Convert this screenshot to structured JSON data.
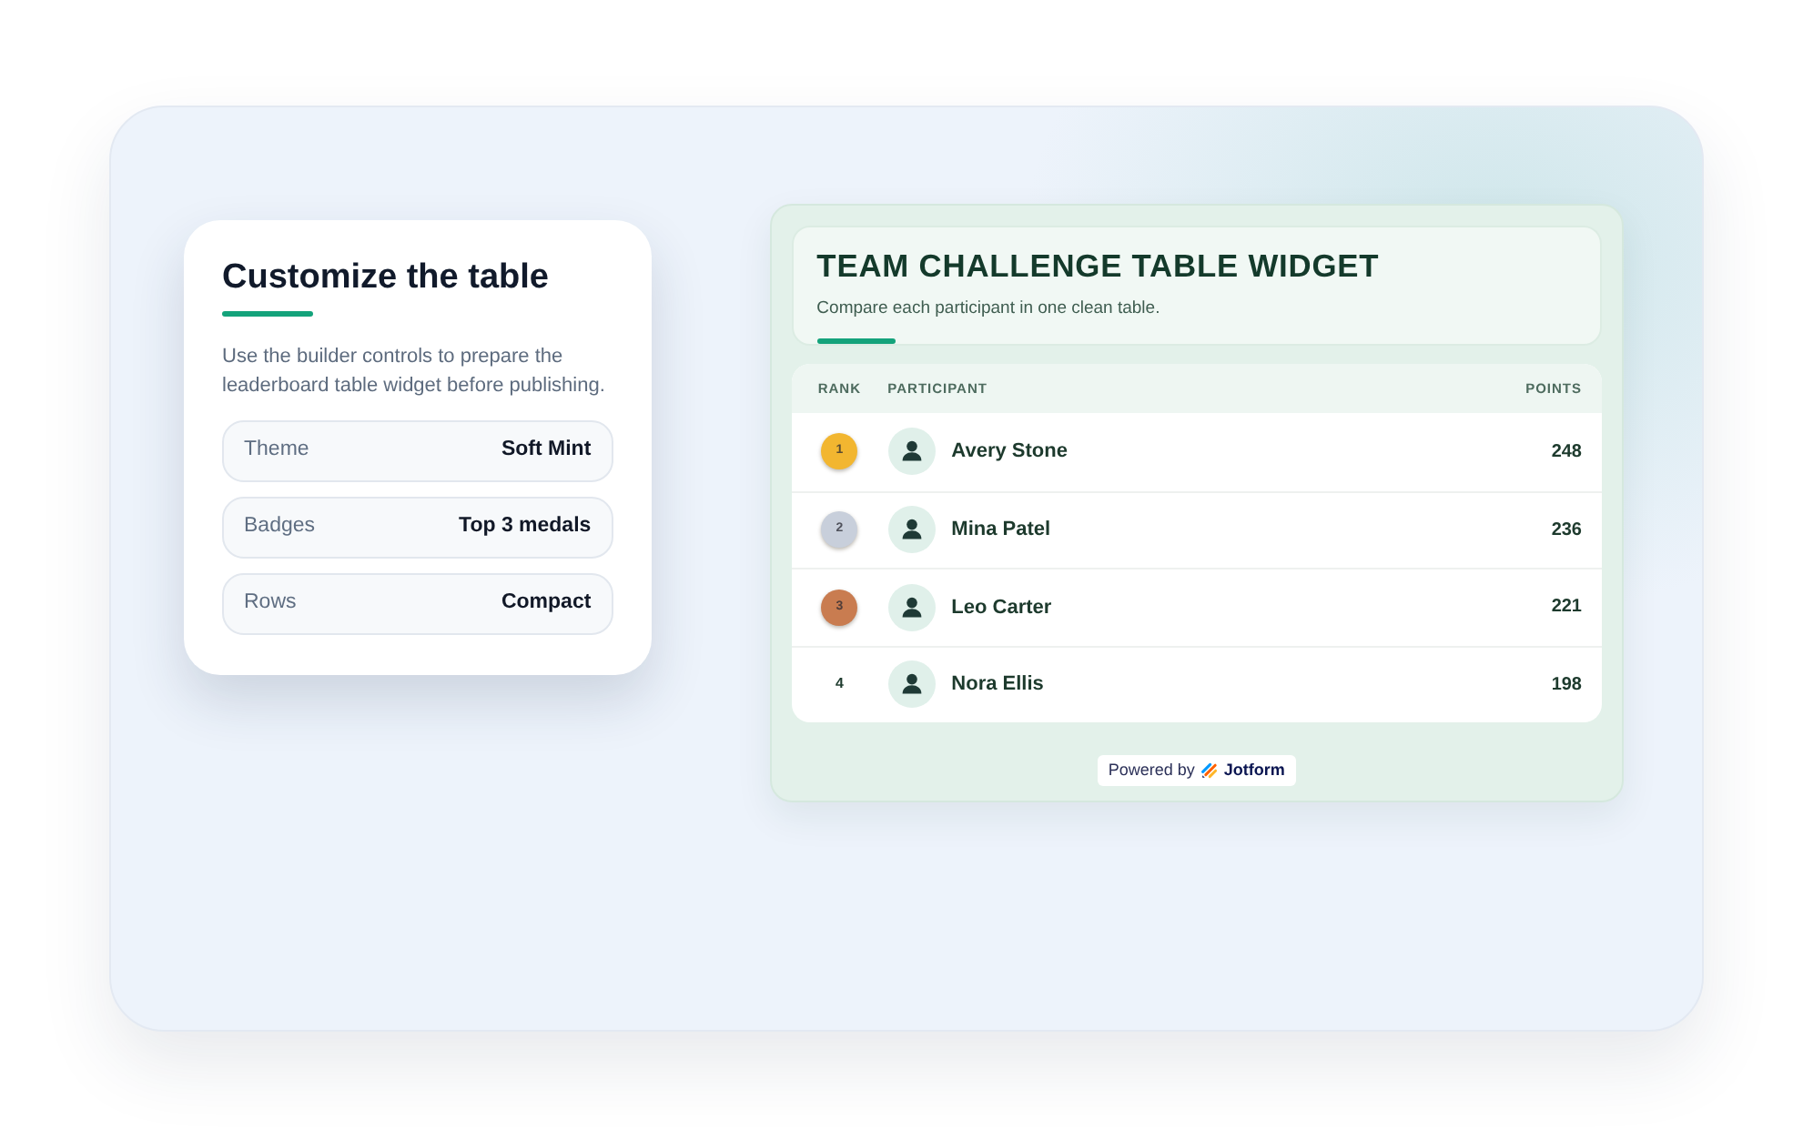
{
  "settings_card": {
    "title": "Customize the table",
    "description": "Use the builder controls to prepare the leaderboard table widget before publishing.",
    "settings": [
      {
        "label": "Theme",
        "value": "Soft Mint"
      },
      {
        "label": "Badges",
        "value": "Top 3 medals"
      },
      {
        "label": "Rows",
        "value": "Compact"
      }
    ]
  },
  "widget": {
    "title": "TEAM CHALLENGE TABLE WIDGET",
    "subtitle": "Compare each participant in one clean table.",
    "table": {
      "columns": [
        "RANK",
        "PARTICIPANT",
        "POINTS"
      ],
      "rows": [
        {
          "rank": "1",
          "color": "#f2b630",
          "name": "Avery Stone",
          "points": "248"
        },
        {
          "rank": "2",
          "color": "#c8cfdb",
          "name": "Mina Patel",
          "points": "236"
        },
        {
          "rank": "3",
          "color": "#c97c50",
          "name": "Leo Carter",
          "points": "221"
        },
        {
          "rank": "4",
          "name": "Nora Ellis",
          "points": "198"
        }
      ]
    },
    "footer": {
      "label": "Powered by",
      "brand": "Jotform"
    }
  }
}
